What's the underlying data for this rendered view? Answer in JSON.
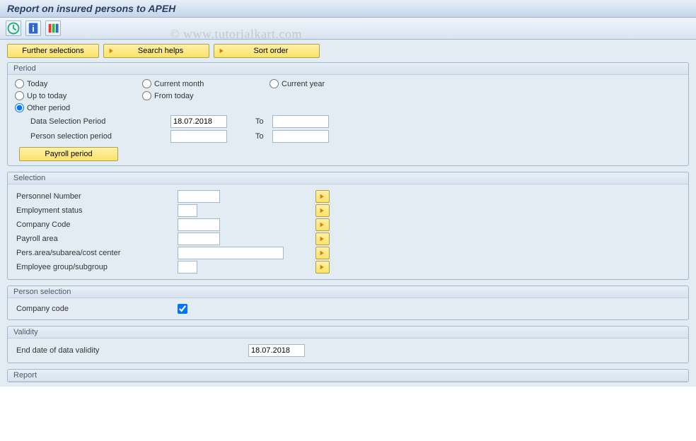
{
  "title": "Report on insured persons to APEH",
  "watermark": "© www.tutorialkart.com",
  "actions": {
    "further": "Further selections",
    "search": "Search helps",
    "sort": "Sort order"
  },
  "period": {
    "title": "Period",
    "radios": {
      "today": "Today",
      "curMonth": "Current month",
      "curYear": "Current year",
      "upTo": "Up to today",
      "fromToday": "From today",
      "other": "Other period"
    },
    "labels": {
      "dataSel": "Data Selection Period",
      "personSel": "Person selection period",
      "to": "To",
      "payroll": "Payroll period"
    },
    "values": {
      "dataDate": "18.07.2018",
      "dataTo": "",
      "personDate": "",
      "personTo": ""
    }
  },
  "selection": {
    "title": "Selection",
    "rows": [
      {
        "label": "Personnel Number",
        "value": "",
        "cls": "w-short"
      },
      {
        "label": "Employment status",
        "value": "",
        "cls": "w-tiny"
      },
      {
        "label": "Company Code",
        "value": "",
        "cls": "w-short"
      },
      {
        "label": "Payroll area",
        "value": "",
        "cls": "w-short"
      },
      {
        "label": "Pers.area/subarea/cost center",
        "value": "",
        "cls": "w-med"
      },
      {
        "label": "Employee group/subgroup",
        "value": "",
        "cls": "w-tiny"
      }
    ]
  },
  "personSel": {
    "title": "Person selection",
    "label": "Company code",
    "checked": true
  },
  "validity": {
    "title": "Validity",
    "label": "End date of data validity",
    "value": "18.07.2018"
  },
  "report": {
    "title": "Report"
  }
}
